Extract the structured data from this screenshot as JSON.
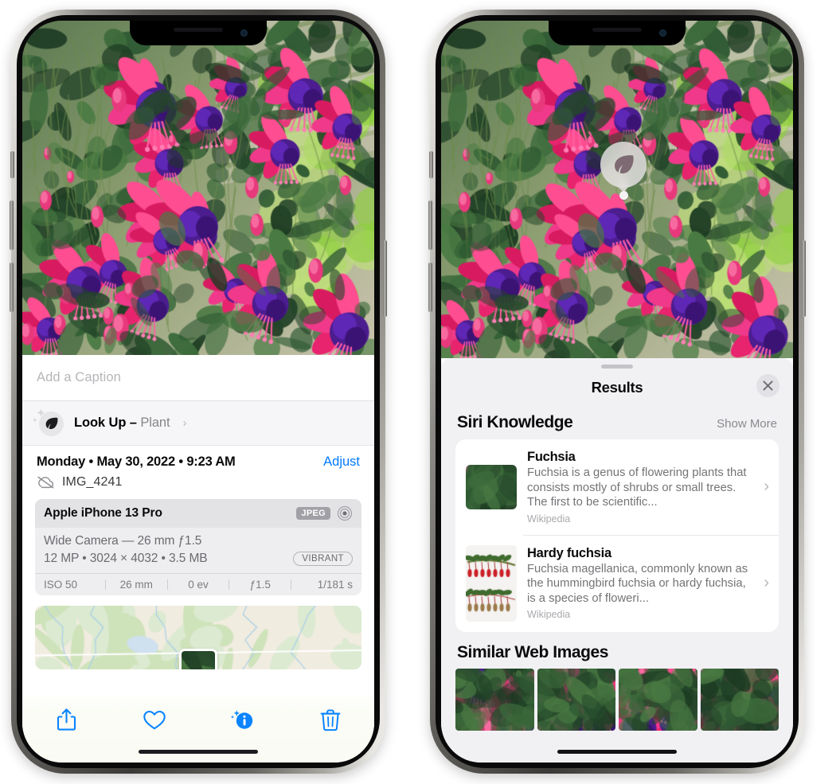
{
  "left_phone": {
    "photo": {
      "alt": "fuchsia-flowers-photo"
    },
    "caption": {
      "placeholder": "Add a Caption",
      "value": ""
    },
    "lookup": {
      "label": "Look Up",
      "dash": " – ",
      "subject": "Plant",
      "chevron": "›",
      "icon": "leaf-icon"
    },
    "meta": {
      "date": "Monday • May 30, 2022 • 9:23 AM",
      "adjust_label": "Adjust",
      "filename": "IMG_4241",
      "cloud_icon": "icloud-slash-icon"
    },
    "exif": {
      "device": "Apple iPhone 13 Pro",
      "format_chip": "JPEG",
      "raw_icon": "raw-badge-icon",
      "lens_line": "Wide Camera — 26 mm ƒ1.5",
      "size_line": "12 MP • 3024 × 4032 • 3.5 MB",
      "style_chip": "VIBRANT",
      "stats": [
        "ISO 50",
        "26 mm",
        "0 ev",
        "ƒ1.5",
        "1/181 s"
      ]
    },
    "map": {
      "label": "location-map"
    },
    "toolbar": [
      {
        "name": "share-button",
        "icon": "share-icon",
        "label": "Share"
      },
      {
        "name": "favorite-button",
        "icon": "heart-icon",
        "label": "Favorite"
      },
      {
        "name": "info-button",
        "icon": "info-sparkle-icon",
        "label": "Info"
      },
      {
        "name": "delete-button",
        "icon": "trash-icon",
        "label": "Delete"
      }
    ]
  },
  "right_phone": {
    "photo": {
      "alt": "fuchsia-flowers-photo"
    },
    "visual_lookup_pin": {
      "icon": "leaf-icon",
      "label": "Visual Look Up"
    },
    "sheet": {
      "title": "Results",
      "close_label": "✕",
      "siri_section": {
        "title": "Siri Knowledge",
        "action": "Show More"
      },
      "results": [
        {
          "title": "Fuchsia",
          "description": "Fuchsia is a genus of flowering plants that consists mostly of shrubs or small trees. The first to be scientific...",
          "source": "Wikipedia",
          "chevron": "›"
        },
        {
          "title": "Hardy fuchsia",
          "description": "Fuchsia magellanica, commonly known as the hummingbird fuchsia or hardy fuchsia, is a species of floweri...",
          "source": "Wikipedia",
          "chevron": "›"
        }
      ],
      "similar_section": {
        "title": "Similar Web Images"
      },
      "similar_images": [
        {
          "alt": "fuchsia-web-image-1"
        },
        {
          "alt": "fuchsia-web-image-2"
        },
        {
          "alt": "fuchsia-web-image-3"
        },
        {
          "alt": "fuchsia-web-image-4"
        }
      ]
    }
  },
  "colors": {
    "accent_blue": "#007aff",
    "sheet_gray": "#f1f1f4",
    "card_white": "#ffffff",
    "text_primary": "#0b0b0c",
    "text_secondary": "#747478",
    "exif_bg": "#eeeef0"
  }
}
